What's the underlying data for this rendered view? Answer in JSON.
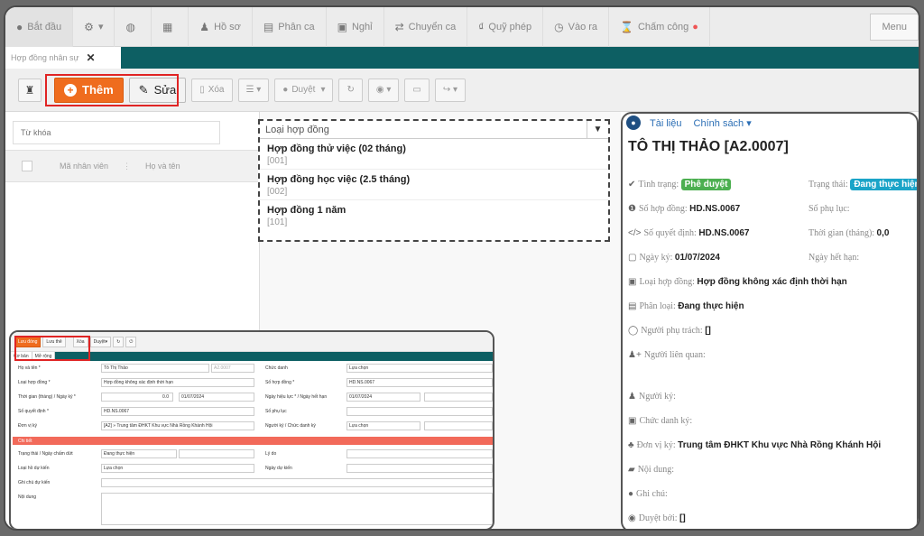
{
  "nav": [
    {
      "icon": "home-icon",
      "label": "Bắt đầu"
    },
    {
      "icon": "gear-icon",
      "label": "▾"
    },
    {
      "icon": "binoculars-icon",
      "label": ""
    },
    {
      "icon": "chart-icon",
      "label": ""
    },
    {
      "icon": "user-icon",
      "label": "Hồ sơ"
    },
    {
      "icon": "calendar-icon",
      "label": "Phân ca"
    },
    {
      "icon": "leave-icon",
      "label": "Nghỉ"
    },
    {
      "icon": "swap-icon",
      "label": "Chuyển ca"
    },
    {
      "icon": "fund-icon",
      "label": "Quỹ phép"
    },
    {
      "icon": "clock-icon",
      "label": "Vào ra"
    },
    {
      "icon": "hourglass-icon",
      "label": "Chấm công"
    }
  ],
  "nav_more": "Menu",
  "tab": {
    "label": "Hợp đồng nhân sự",
    "close": "✕"
  },
  "toolbar": {
    "add_label": "Thêm",
    "edit_label": "Sửa",
    "delete_label": "Xóa",
    "approve_label": "Duyệt"
  },
  "left": {
    "search_placeholder": "Từ khóa",
    "col_code": "Mã nhân viên",
    "col_name": "Họ và tên"
  },
  "dropdown": {
    "header": "Loại hợp đồng",
    "options": [
      {
        "name": "Hợp đồng thử việc (02 tháng)",
        "code": "[001]"
      },
      {
        "name": "Hợp đồng học việc (2.5 tháng)",
        "code": "[002]"
      },
      {
        "name": "Hợp đồng 1 năm",
        "code": "[101]"
      }
    ]
  },
  "detail": {
    "links": [
      "Tài liệu",
      "Chính sách ▾"
    ],
    "title": "TÔ THỊ THẢO [A2.0007]",
    "status_label": "Tình trạng:",
    "status_value": "Phê duyệt",
    "state_label": "Trạng thái:",
    "state_value": "Đang thực hiện",
    "contract_no_label": "Số hợp đồng:",
    "contract_no": "HD.NS.0067",
    "appendix_label": "Số phụ lục:",
    "decision_label": "Số quyết định:",
    "decision_no": "HD.NS.0067",
    "duration_label": "Thời gian (tháng):",
    "duration": "0,0",
    "sign_date_label": "Ngày ký:",
    "sign_date": "01/07/2024",
    "expiry_label": "Ngày hết hạn:",
    "type_label": "Loại hợp đồng:",
    "type_value": "Hợp đồng không xác định thời hạn",
    "class_label": "Phân loại:",
    "class_value": "Đang thực hiện",
    "owner_label": "Người phụ trách:",
    "owner_value": "[]",
    "related_label": "Người liên quan:",
    "signer_label": "Người ký:",
    "signer_title_label": "Chức danh ký:",
    "unit_label": "Đơn vị ký:",
    "unit_value": "Trung tâm ĐHKT Khu vực Nhà Rồng Khánh Hội",
    "content_label": "Nội dung:",
    "note_label": "Ghi chú:",
    "approver_label": "Duyệt bởi:",
    "approver_value": "[]"
  },
  "thumb": {
    "save": "Lưu đóng",
    "save2": "Lưu thê",
    "del": "Xóa",
    "approve": "Duyệt",
    "tab1": "Cơ bản",
    "tab2": "Mở rộng",
    "name_lbl": "Họ và tên *",
    "name_val": "Tô Thị Thảo",
    "code_val": "A2.0007",
    "title_lbl": "Chức danh",
    "title_val": "Lựa chọn",
    "type_lbl": "Loại hợp đồng *",
    "type_val": "Hợp đồng không xác định thời hạn",
    "no_lbl": "Số hợp đồng *",
    "no_val": "HD.NS.0067",
    "time_lbl": "Thời gian (tháng) / Ngày ký *",
    "time_val": "0.0",
    "date_val": "01/07/2024",
    "eff_lbl": "Ngày hiệu lực * / Ngày hết hạn",
    "eff_val": "01/07/2024",
    "dec_lbl": "Số quyết định *",
    "dec_val": "HD.NS.0067",
    "app_lbl": "Số phụ lục",
    "unit_lbl": "Đơn vị ký",
    "unit_val": "[A2] » Trung tâm ĐHKT Khu vực Nhà Rồng Khánh Hội",
    "signer_lbl": "Người ký / Chức danh ký",
    "signer_val": "Lựa chọn",
    "section": "Chi tiết",
    "st_lbl": "Trạng thái / Ngày chấm dứt",
    "st_val": "Đang thực hiện",
    "reason_lbl": "Lý do",
    "ltype_lbl": "Loại hồ dự kiến",
    "ltype_val": "Lựa chọn",
    "ldate_lbl": "Ngày dự kiến",
    "note_lbl": "Ghi chú dự kiến",
    "content_lbl": "Nội dung"
  }
}
